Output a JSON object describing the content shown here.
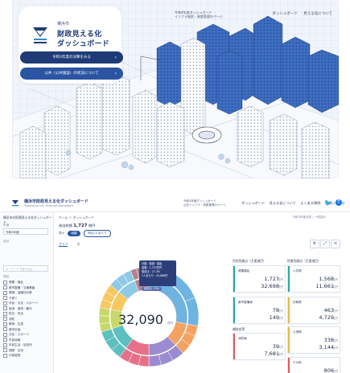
{
  "top": {
    "org": "横浜市",
    "title_line1": "財政見える化",
    "title_line2": "ダッシュボード",
    "button1": "令和3年度の決算をみる",
    "button2": "公共（公共施設）の状況について",
    "note_line1": "令和4年度ダッシュボード",
    "note_line2": "インフラ施設・資産管理のページ",
    "nav": [
      "ダッシュボード",
      "見える化について"
    ]
  },
  "bottom": {
    "header": {
      "title": "横浜市財政見える化ダッシュボード",
      "subtitle": "Yokohama city financial dashboard",
      "note_line1": "令和4年度ダッシュボード",
      "note_line2": "公共インフラ・資産管理のページ",
      "nav": [
        "ダッシュボード",
        "見える化について",
        "よくある質問",
        "お問い合わせ"
      ],
      "twitter": "🐦",
      "facebook": "f"
    },
    "sidebar": {
      "title": "横浜市の財政見える化ダッシュボード",
      "label1": "年度",
      "select1": "令和3年度",
      "label2": "会計",
      "search_placeholder": "キーワードで絞り込む",
      "list_header": "項目",
      "items": [
        "健康・福祉",
        "都市整備・交通基盤",
        "環境・温暖化対策",
        "子育て",
        "市民・文化・スポーツ",
        "経済・港湾・観光",
        "防災・安全",
        "消防",
        "教育・生涯",
        "都市計画",
        "文化・スポーツ",
        "市民協働",
        "市民生活・区役所",
        "国際・交流",
        "行政経営"
      ]
    },
    "main": {
      "crumb": "ホーム ＞ ダッシュボード",
      "crumb_right": "令和3年度決算 / 一般会計",
      "metric_label": "歳出総額",
      "metric_value": "1,727",
      "metric_unit": "億円",
      "filter_label": "表示",
      "pill1": "総額",
      "pill2": "市民1人あたり",
      "tab1": "グラフ",
      "tab2": "表",
      "tool1": "⚙",
      "tool2": "⤢",
      "tool3": "≡",
      "tooltip_lines": [
        "分類：健康・福祉",
        "金額：1,727億円",
        "構成比：27.3%",
        "1人あたり：45,888円"
      ],
      "tooltip_badge": "前年比 ＋3%",
      "total_value": "32,090",
      "total_unit": "億円",
      "column_left_title": "目的別歳出（主要項目）",
      "column_right_title": "性質別歳出（主要項目）",
      "cards_left": [
        {
          "name": "健康福祉",
          "v1": "1,727",
          "u1": "億円",
          "v2": "32,698",
          "u2": "億円",
          "color": "#2aa6a0"
        },
        {
          "name": "都市整備局",
          "v1": "78",
          "u1": "億円",
          "v2": "149",
          "u2": "億円",
          "color": "#2aa6a0"
        },
        {
          "name": "消防局",
          "v1": "39",
          "u1": "億円",
          "v2": "7,681",
          "u2": "億円",
          "color": "#e05a5a"
        }
      ],
      "cards_right": [
        {
          "name": "人件費",
          "v1": "1,568",
          "u1": "億円",
          "v2": "11,661",
          "u2": "億円",
          "color": "#2aa6a0"
        },
        {
          "name": "扶助費",
          "v1": "463",
          "u1": "億円",
          "v2": "4,729",
          "u2": "億円",
          "color": "#e8b93b"
        },
        {
          "name": "公債費",
          "v1": "338",
          "u1": "億円",
          "v2": "3,144",
          "u2": "億円",
          "color": "#e8b93b"
        },
        {
          "name": "その他",
          "v1": "806",
          "u1": "億円",
          "v2": "7,771",
          "u2": "億円",
          "color": "#e05a5a"
        }
      ],
      "card_group_label": "補助金等"
    }
  }
}
